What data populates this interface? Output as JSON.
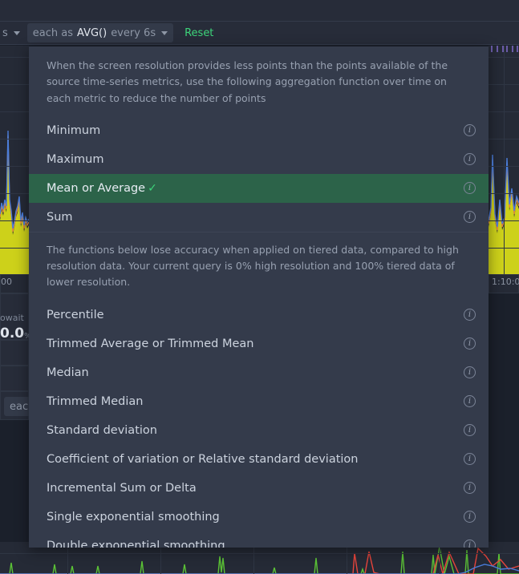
{
  "toolbar": {
    "left_chip_label": "s",
    "aggregation_chip": {
      "prefix": "each as",
      "value": "AVG()",
      "suffix": "every 6s"
    },
    "reset_label": "Reset",
    "chip_caret_icon": "chevron-down-icon"
  },
  "dropdown": {
    "intro_note": "When the screen resolution provides less points than the points available of the source time-series metrics, use the following aggregation function over time on each metric to reduce the number of points",
    "tiered_note": "The functions below lose accuracy when applied on tiered data, compared to high resolution data. Your current query is 0% high resolution and 100% tiered data of lower resolution.",
    "selected": "Mean or Average",
    "check_glyph": "✓",
    "info_glyph": "i",
    "primary_options": [
      {
        "label": "Minimum",
        "selected": false
      },
      {
        "label": "Maximum",
        "selected": false
      },
      {
        "label": "Mean or Average",
        "selected": true
      },
      {
        "label": "Sum",
        "selected": false
      }
    ],
    "secondary_options": [
      {
        "label": "Percentile",
        "selected": false
      },
      {
        "label": "Trimmed Average or Trimmed Mean",
        "selected": false
      },
      {
        "label": "Median",
        "selected": false
      },
      {
        "label": "Trimmed Median",
        "selected": false
      },
      {
        "label": "Standard deviation",
        "selected": false
      },
      {
        "label": "Coefficient of variation or Relative standard deviation",
        "selected": false
      },
      {
        "label": "Incremental Sum or Delta",
        "selected": false
      },
      {
        "label": "Single exponential smoothing",
        "selected": false
      },
      {
        "label": "Double exponential smoothing",
        "selected": false
      }
    ]
  },
  "background": {
    "left_axis_tick": "00",
    "right_axis_tick": "1:10:0",
    "metric_name": "owait",
    "metric_value": "0.0",
    "metric_unit": "%",
    "bottom_chip_label": "each"
  },
  "colors": {
    "accent_green": "#3dd47a",
    "selected_row": "#2c6349",
    "menu_bg": "#343b4b",
    "panel_bg": "#272c39",
    "page_bg": "#1b202b",
    "chart_area_fill": "#cdd11a",
    "chart_line_orange": "#e08a3c",
    "chart_line_blue": "#4a7ddb",
    "chart_line_green": "#5bc236",
    "chart_line_red": "#e8453c",
    "tick_purple": "#6a5ba8"
  }
}
